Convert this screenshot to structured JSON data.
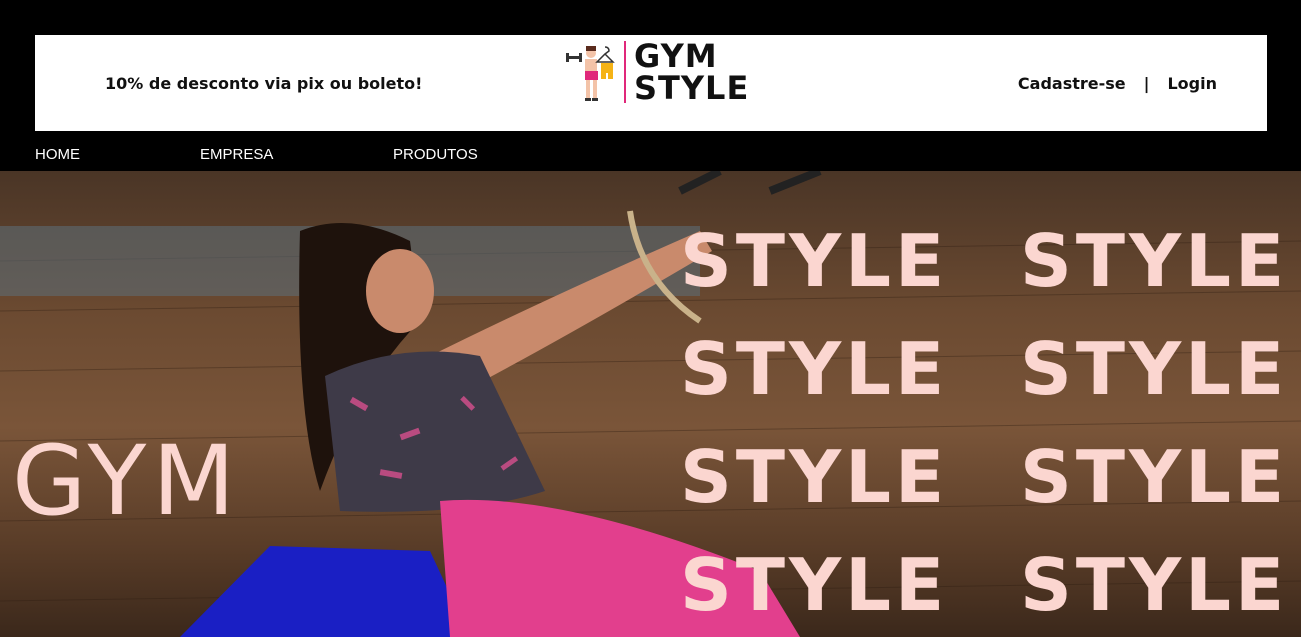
{
  "header": {
    "promo_text": "10% de desconto via pix ou boleto!",
    "logo_line1": "GYM",
    "logo_line2": "STYLE",
    "signup_label": "Cadastre-se",
    "separator": "|",
    "login_label": "Login"
  },
  "nav": {
    "items": [
      {
        "label": "HOME"
      },
      {
        "label": "EMPRESA"
      },
      {
        "label": "PRODUTOS"
      }
    ]
  },
  "hero": {
    "left_word": "GYM",
    "repeated_word": "STYLE",
    "colors": {
      "text": "#fbd6d0",
      "accent": "#e0287a"
    }
  }
}
